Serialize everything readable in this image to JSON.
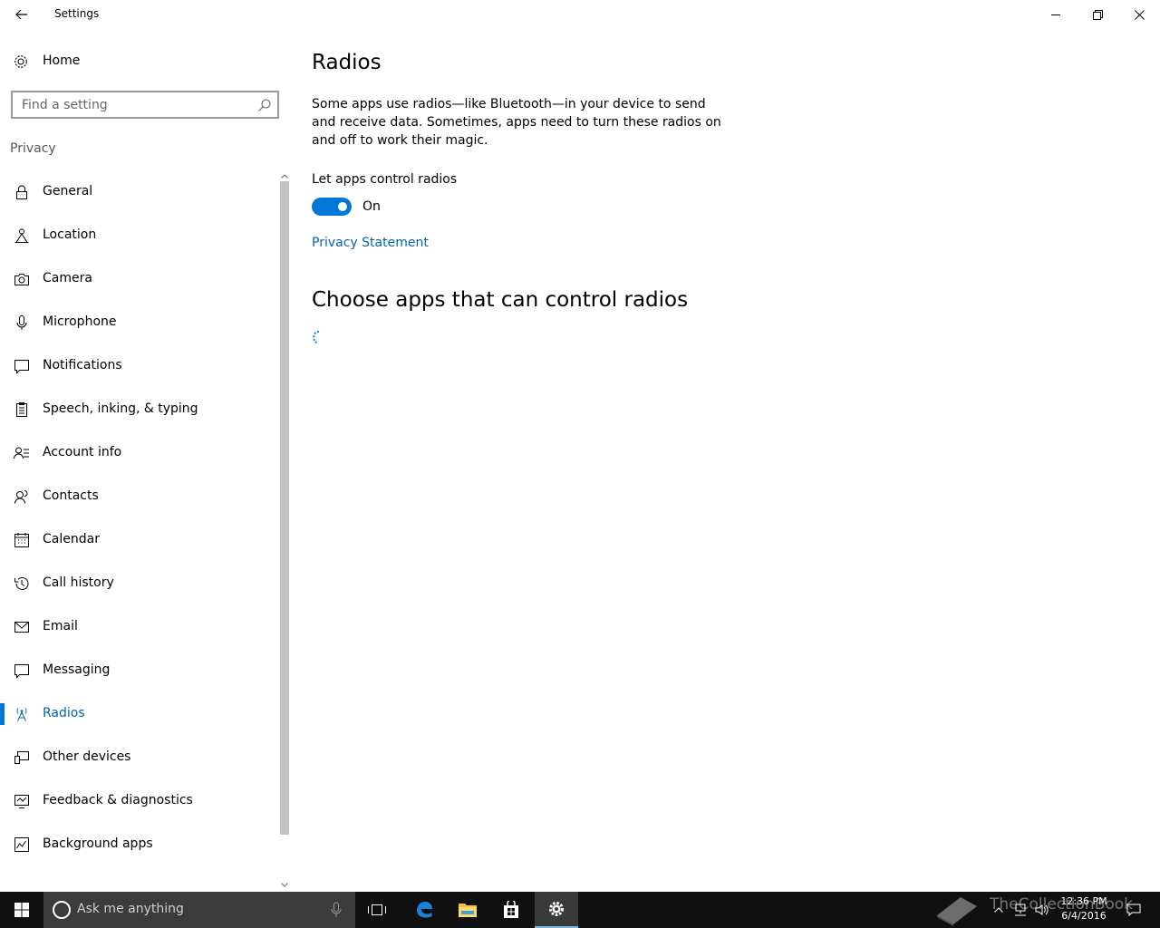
{
  "window": {
    "title": "Settings"
  },
  "sidebar": {
    "home_label": "Home",
    "search_placeholder": "Find a setting",
    "section_label": "Privacy",
    "items": [
      {
        "label": "General",
        "icon": "lock-icon"
      },
      {
        "label": "Location",
        "icon": "location-icon"
      },
      {
        "label": "Camera",
        "icon": "camera-icon"
      },
      {
        "label": "Microphone",
        "icon": "microphone-icon"
      },
      {
        "label": "Notifications",
        "icon": "notifications-icon"
      },
      {
        "label": "Speech, inking, & typing",
        "icon": "speech-icon"
      },
      {
        "label": "Account info",
        "icon": "account-info-icon"
      },
      {
        "label": "Contacts",
        "icon": "contacts-icon"
      },
      {
        "label": "Calendar",
        "icon": "calendar-icon"
      },
      {
        "label": "Call history",
        "icon": "call-history-icon"
      },
      {
        "label": "Email",
        "icon": "email-icon"
      },
      {
        "label": "Messaging",
        "icon": "messaging-icon"
      },
      {
        "label": "Radios",
        "icon": "radios-icon",
        "active": true
      },
      {
        "label": "Other devices",
        "icon": "other-devices-icon"
      },
      {
        "label": "Feedback & diagnostics",
        "icon": "feedback-icon"
      },
      {
        "label": "Background apps",
        "icon": "background-apps-icon"
      }
    ]
  },
  "content": {
    "title": "Radios",
    "description": "Some apps use radios—like Bluetooth—in your device to send and receive data. Sometimes, apps need to turn these radios on and off to work their magic.",
    "toggle_label": "Let apps control radios",
    "toggle_state": "On",
    "toggle_on": true,
    "privacy_link": "Privacy Statement",
    "apps_title": "Choose apps that can control radios"
  },
  "taskbar": {
    "search_text": "Ask me anything",
    "time": "12:36 PM",
    "date": "6/4/2016",
    "watermark": "TheCollectionBook"
  },
  "colors": {
    "accent": "#0078d7",
    "link": "#0063b1",
    "taskbar": "#101010"
  }
}
